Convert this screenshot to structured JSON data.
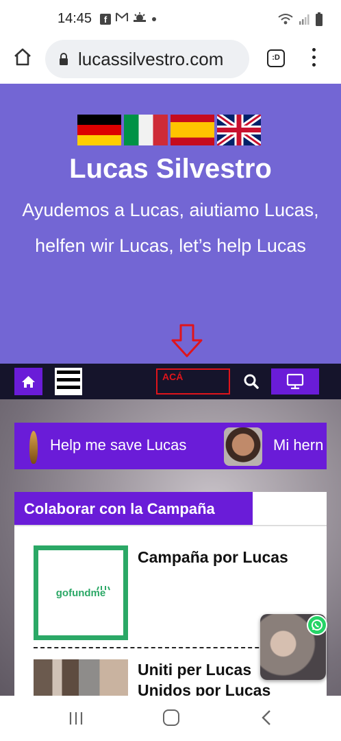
{
  "status_bar": {
    "time": "14:45",
    "left_icons": [
      "facebook-icon",
      "gmail-icon",
      "weather-icon",
      "dot-icon"
    ],
    "right_icons": [
      "wifi-icon",
      "signal-icon",
      "battery-icon"
    ]
  },
  "browser": {
    "url": "lucassilvestro.com",
    "tab_count": ":D"
  },
  "hero": {
    "flags": [
      "germany",
      "italy",
      "spain",
      "united-kingdom"
    ],
    "title": "Lucas Silvestro",
    "subtitle": "Ayudemos a Lucas, aiutiamo Lucas, helfen wir Lucas, let’s help Lucas"
  },
  "nav": {
    "aca_label": "ACÁ"
  },
  "ticker": {
    "item1": "Help me save Lucas",
    "item2": "Mi hern"
  },
  "campaign": {
    "heading": "Colaborar con la Campaña",
    "items": [
      {
        "title": "Campaña por Lucas",
        "logo_text": "gofundme"
      },
      {
        "title_line1": "Uniti per Lucas",
        "title_line2": "Unidos por Lucas"
      }
    ]
  },
  "colors": {
    "hero_bg": "#7366d4",
    "accent_purple": "#6a1cd8",
    "nav_bg": "#15142b",
    "gofundme_green": "#2ba866",
    "alert_red": "#e0141b",
    "whatsapp_green": "#25d366"
  }
}
